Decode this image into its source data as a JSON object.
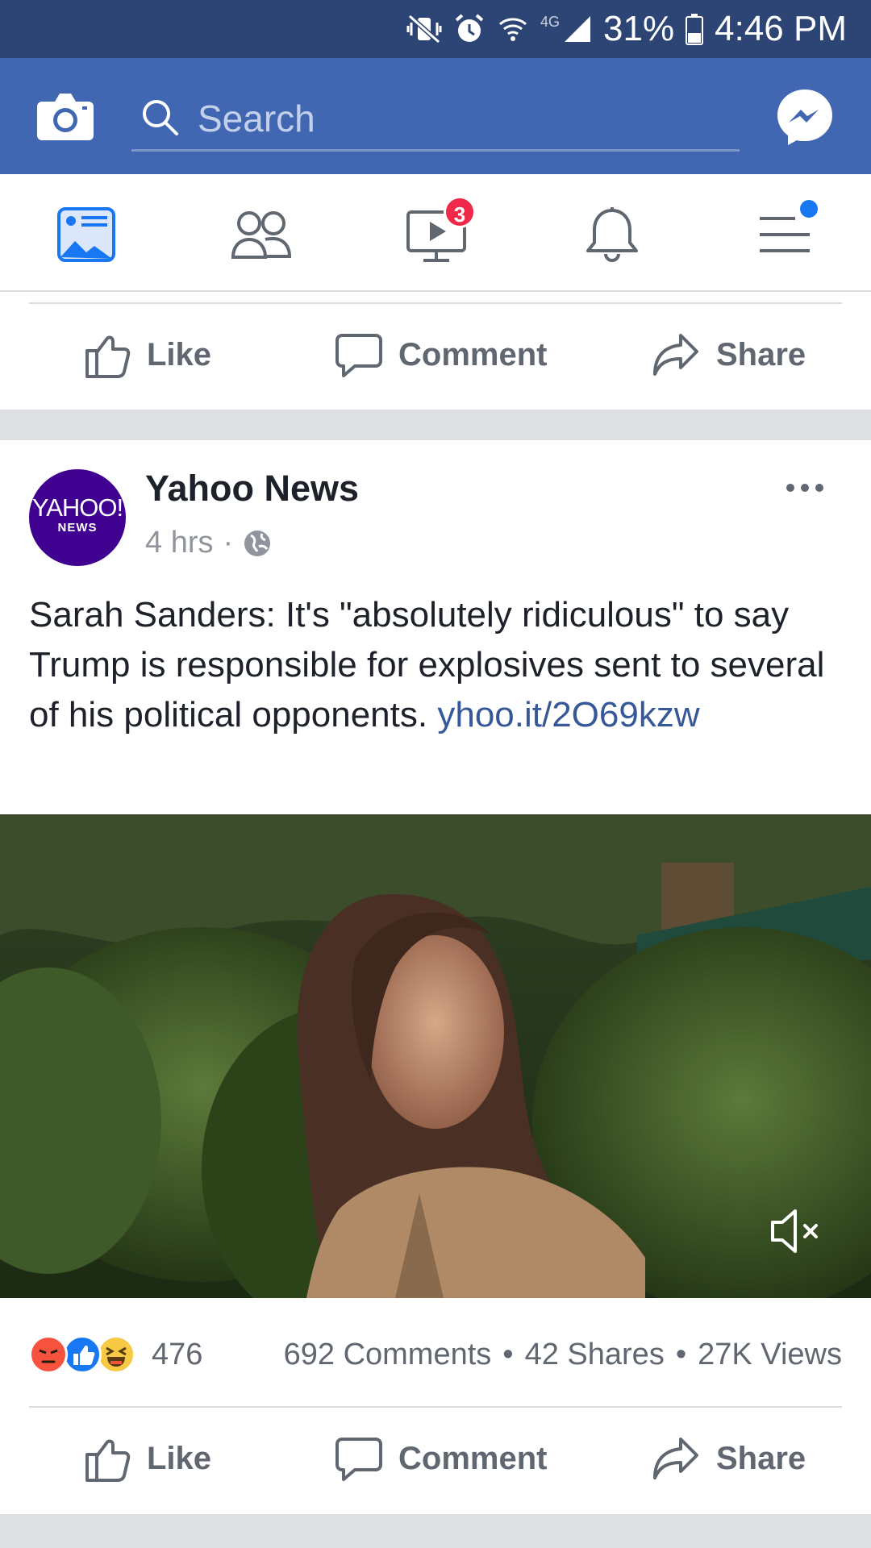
{
  "status_bar": {
    "network": "4G",
    "battery": "31%",
    "time": "4:46 PM"
  },
  "header": {
    "search_placeholder": "Search"
  },
  "tabs": {
    "watch_badge": "3"
  },
  "top_actions": {
    "like": "Like",
    "comment": "Comment",
    "share": "Share"
  },
  "post": {
    "avatar_logo": "YAHOO!",
    "avatar_logo_sub": "NEWS",
    "page_name": "Yahoo News",
    "time": "4 hrs",
    "separator": "·",
    "text": "Sarah Sanders: It's \"absolutely ridiculous\" to say Trump is responsible for explosives sent to several of his political opponents.",
    "link": "yhoo.it/2O69kzw",
    "reaction_count": "476",
    "comments": "692 Comments",
    "shares": "42 Shares",
    "views": "27K Views",
    "stats_separator": "•"
  },
  "bottom_actions": {
    "like": "Like",
    "comment": "Comment",
    "share": "Share"
  },
  "colors": {
    "status_bar": "#2d4574",
    "brand_blue": "#4267b2",
    "link": "#365899",
    "badge_red": "#f02849",
    "divider": "#dddfe2"
  }
}
